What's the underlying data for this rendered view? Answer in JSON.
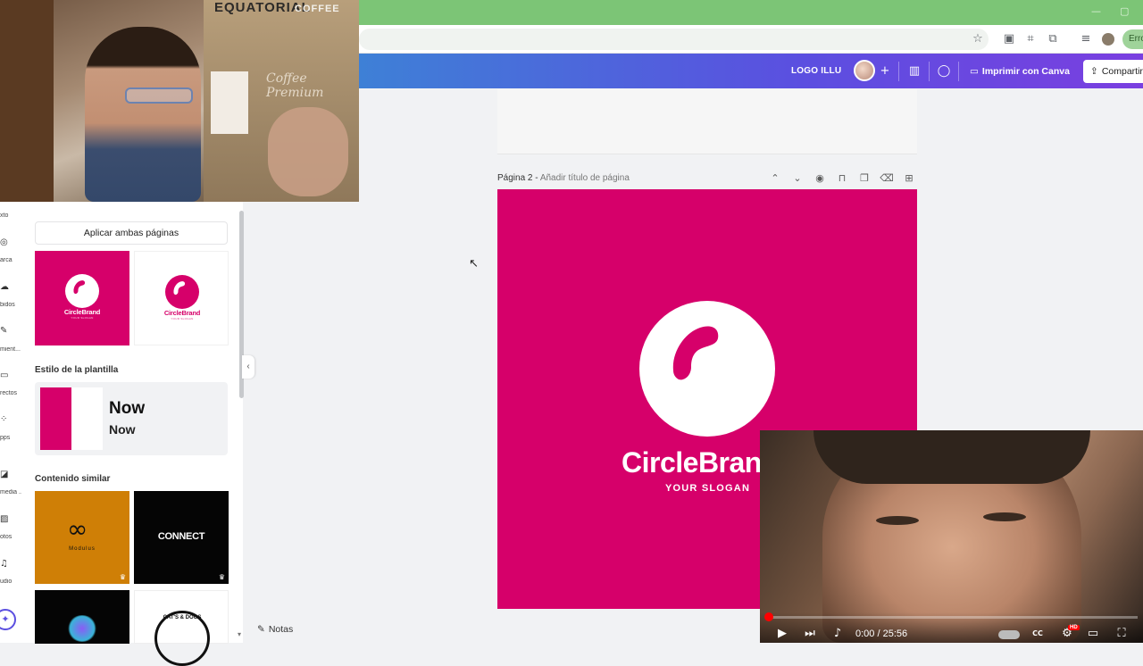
{
  "browser": {
    "error_pill": "Erro",
    "window_controls": [
      "—",
      "▢"
    ]
  },
  "canva_header": {
    "design_name": "LOGO ILLU",
    "print_label": "Imprimir con Canva",
    "share_label": "Compartir"
  },
  "left_rail": {
    "items": [
      "xto",
      "arca",
      "bidos",
      "mient...",
      "rectos",
      "pps",
      "media ...",
      "otos",
      "udio"
    ]
  },
  "panel": {
    "apply_both_label": "Aplicar ambas páginas",
    "template_style_title": "Estilo de la plantilla",
    "style_heading": "Now",
    "style_body": "Now",
    "similar_title": "Contenido similar",
    "thumb_brand": "CircleBrand",
    "thumb_slogan": "YOUR SLOGAN",
    "similar_items": [
      {
        "label": "Modulus",
        "sub": "Modulus"
      },
      {
        "label": "CONNECT"
      },
      {
        "label": ""
      },
      {
        "label": "CAT'S & DOGS"
      }
    ]
  },
  "canvas": {
    "page_label": "Página 2 - ",
    "page_title_placeholder": "Añadir título de página",
    "brand": "CircleBrand",
    "slogan": "YOUR SLOGAN",
    "notes_label": "Notas",
    "brand_color": "#d6006a"
  },
  "webcam_top_left": {
    "bag_brand": "EQUATORIAL",
    "bag_coffee": "COFFEE",
    "bag_label": "Coffee Premium"
  },
  "video_player": {
    "time": "0:00 / 25:56",
    "hd_badge": "HD",
    "cc_label": "CC"
  }
}
